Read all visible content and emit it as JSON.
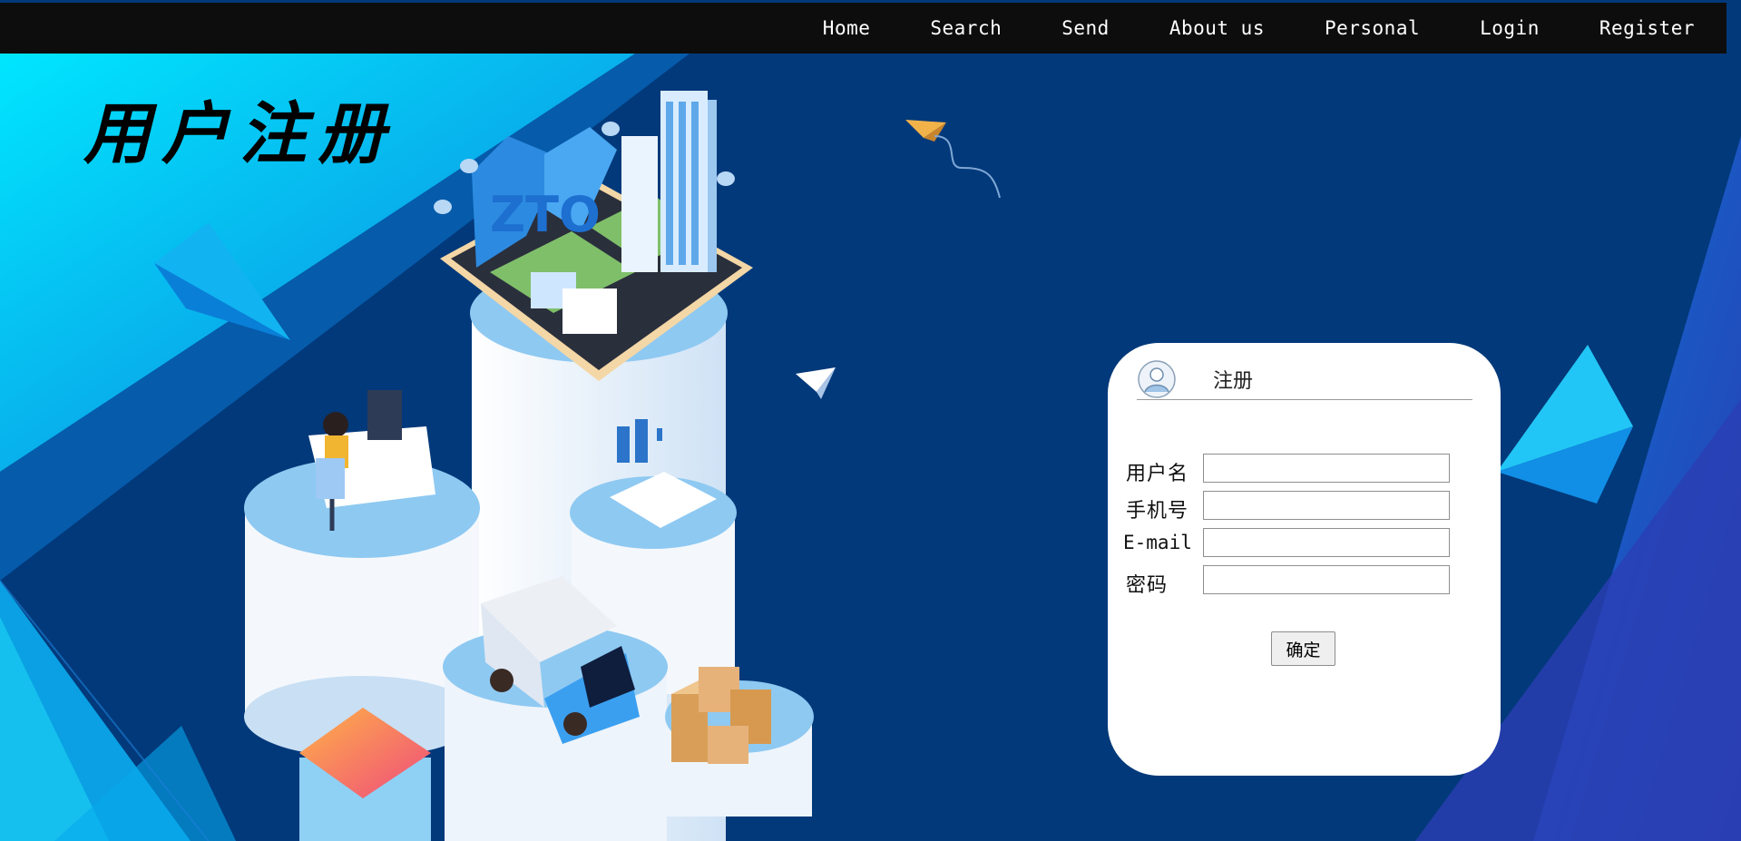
{
  "nav": {
    "items": [
      {
        "label": "Home"
      },
      {
        "label": "Search"
      },
      {
        "label": "Send"
      },
      {
        "label": "About us"
      },
      {
        "label": "Personal"
      },
      {
        "label": "Login"
      },
      {
        "label": "Register"
      }
    ]
  },
  "page": {
    "title": "用户注册",
    "illustration_icon": "logistics-city-illustration-icon",
    "logo_text": "ZTO"
  },
  "register_card": {
    "title": "注册",
    "avatar_icon": "user-avatar-icon",
    "fields": [
      {
        "label": "用户名",
        "value": ""
      },
      {
        "label": "手机号",
        "value": ""
      },
      {
        "label": "E-mail",
        "value": ""
      },
      {
        "label": "密码",
        "value": ""
      }
    ],
    "submit_label": "确定"
  },
  "colors": {
    "nav_bg": "#0d0d0d",
    "bg_dark_navy": "#02397a",
    "bg_cyan": "#08c8ee",
    "card_bg": "#ffffff",
    "box_orange": "#e6b27a"
  }
}
